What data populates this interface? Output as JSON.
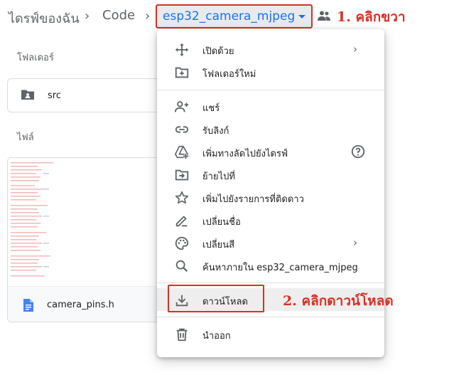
{
  "breadcrumb": {
    "root": "ไดรฟ์ของฉัน",
    "separator": "›",
    "middle": "Code",
    "current": "esp32_camera_mjpeg"
  },
  "annotations": {
    "step1": "1. คลิกขวา",
    "step2": "2. คลิกดาวน์โหลด"
  },
  "main": {
    "folders_label": "โฟลเดอร์",
    "folder_name": "src",
    "files_label": "ไฟล์",
    "file_name": "camera_pins.h"
  },
  "menu": {
    "items": [
      {
        "icon": "move-arrows-icon",
        "label": "เปิดด้วย",
        "submenu": "›"
      },
      {
        "icon": "new-folder-icon",
        "label": "โฟลเดอร์ใหม่"
      },
      {
        "icon": "add-person-icon",
        "label": "แชร์"
      },
      {
        "icon": "link-icon",
        "label": "รับลิงก์"
      },
      {
        "icon": "add-to-drive-icon",
        "label": "เพิ่มทางลัดไปยังไดรฟ์",
        "help": "help-icon"
      },
      {
        "icon": "move-to-icon",
        "label": "ย้ายไปที่"
      },
      {
        "icon": "star-icon",
        "label": "เพิ่มไปยังรายการที่ติดดาว"
      },
      {
        "icon": "rename-pencil-icon",
        "label": "เปลี่ยนชื่อ"
      },
      {
        "icon": "palette-icon",
        "label": "เปลี่ยนสี",
        "submenu": "›"
      },
      {
        "icon": "search-icon",
        "label": "ค้นหาภายใน esp32_camera_mjpeg"
      },
      {
        "icon": "download-icon",
        "label": "ดาวน์โหลด"
      },
      {
        "icon": "trash-icon",
        "label": "นำออก"
      }
    ]
  },
  "colors": {
    "annotation_red": "#d93025",
    "link_blue": "#1a73e8",
    "icon_gray": "#5f6368",
    "hover_gray": "#eeeeee"
  }
}
